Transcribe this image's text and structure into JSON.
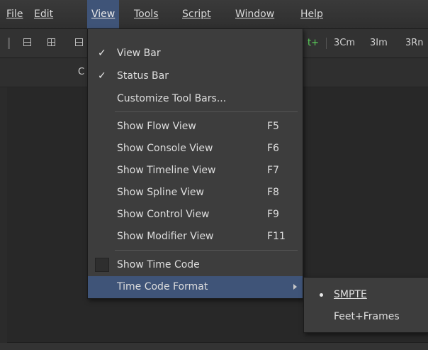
{
  "menubar": {
    "items": [
      {
        "label": "File"
      },
      {
        "label": "Edit"
      },
      {
        "label": "View"
      },
      {
        "label": "Tools"
      },
      {
        "label": "Script"
      },
      {
        "label": "Window"
      },
      {
        "label": "Help"
      }
    ]
  },
  "toolbar": {
    "green_label": "t+",
    "layout_3cm": "3Cm",
    "layout_3im": "3Im",
    "layout_3rn": "3Rn"
  },
  "viewbar": {
    "label_fragment": "C"
  },
  "view_menu": {
    "items": [
      {
        "label": "View Bar",
        "checked": true
      },
      {
        "label": "Status Bar",
        "checked": true
      },
      {
        "label": "Customize Tool Bars..."
      },
      {
        "label": "Show Flow View",
        "shortcut": "F5"
      },
      {
        "label": "Show Console View",
        "shortcut": "F6"
      },
      {
        "label": "Show Timeline View",
        "shortcut": "F7"
      },
      {
        "label": "Show Spline View",
        "shortcut": "F8"
      },
      {
        "label": "Show Control View",
        "shortcut": "F9"
      },
      {
        "label": "Show Modifier View",
        "shortcut": "F11"
      },
      {
        "label": "Show Time Code",
        "checked": false
      },
      {
        "label": "Time Code Format",
        "highlighted": true,
        "has_submenu": true
      }
    ],
    "check_glyph": "✓"
  },
  "timecode_submenu": {
    "items": [
      {
        "label": "SMPTE",
        "selected": true
      },
      {
        "label": "Feet+Frames"
      }
    ]
  },
  "colors": {
    "highlight": "#3f5478",
    "menu_bg": "#3d3d3d",
    "background": "#2b2b2b"
  }
}
